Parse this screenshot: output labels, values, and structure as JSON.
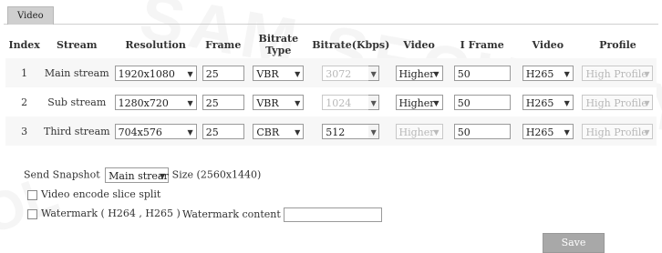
{
  "tab": {
    "label": "Video"
  },
  "headers": [
    "Index",
    "Stream",
    "Resolution",
    "Frame",
    "Bitrate Type",
    "Bitrate(Kbps)",
    "Video",
    "I Frame",
    "Video",
    "Profile"
  ],
  "rows": [
    {
      "index": "1",
      "stream": "Main stream",
      "resolution": "1920x1080",
      "frame": "25",
      "bitrate_type": "VBR",
      "bitrate": "3072",
      "bitrate_disabled": true,
      "video_quality": "Higher",
      "quality_disabled": false,
      "iframe": "50",
      "codec": "H265",
      "profile": "High Profile"
    },
    {
      "index": "2",
      "stream": "Sub stream",
      "resolution": "1280x720",
      "frame": "25",
      "bitrate_type": "VBR",
      "bitrate": "1024",
      "bitrate_disabled": true,
      "video_quality": "Higher",
      "quality_disabled": false,
      "iframe": "50",
      "codec": "H265",
      "profile": "High Profile"
    },
    {
      "index": "3",
      "stream": "Third stream",
      "resolution": "704x576",
      "frame": "25",
      "bitrate_type": "CBR",
      "bitrate": "512",
      "bitrate_disabled": false,
      "video_quality": "Higher",
      "quality_disabled": true,
      "iframe": "50",
      "codec": "H265",
      "profile": "High Profile"
    }
  ],
  "snapshot": {
    "label": "Send Snapshot",
    "value": "Main strear",
    "size_label": "Size",
    "size_value": "(2560x1440)"
  },
  "slice_split": {
    "label": "Video encode slice split"
  },
  "watermark": {
    "label": "Watermark ( H264 , H265 )",
    "content_label": "Watermark content",
    "content_value": ""
  },
  "save_button": {
    "label": "Save"
  },
  "watermark_text": "OLSAM SECURITY"
}
